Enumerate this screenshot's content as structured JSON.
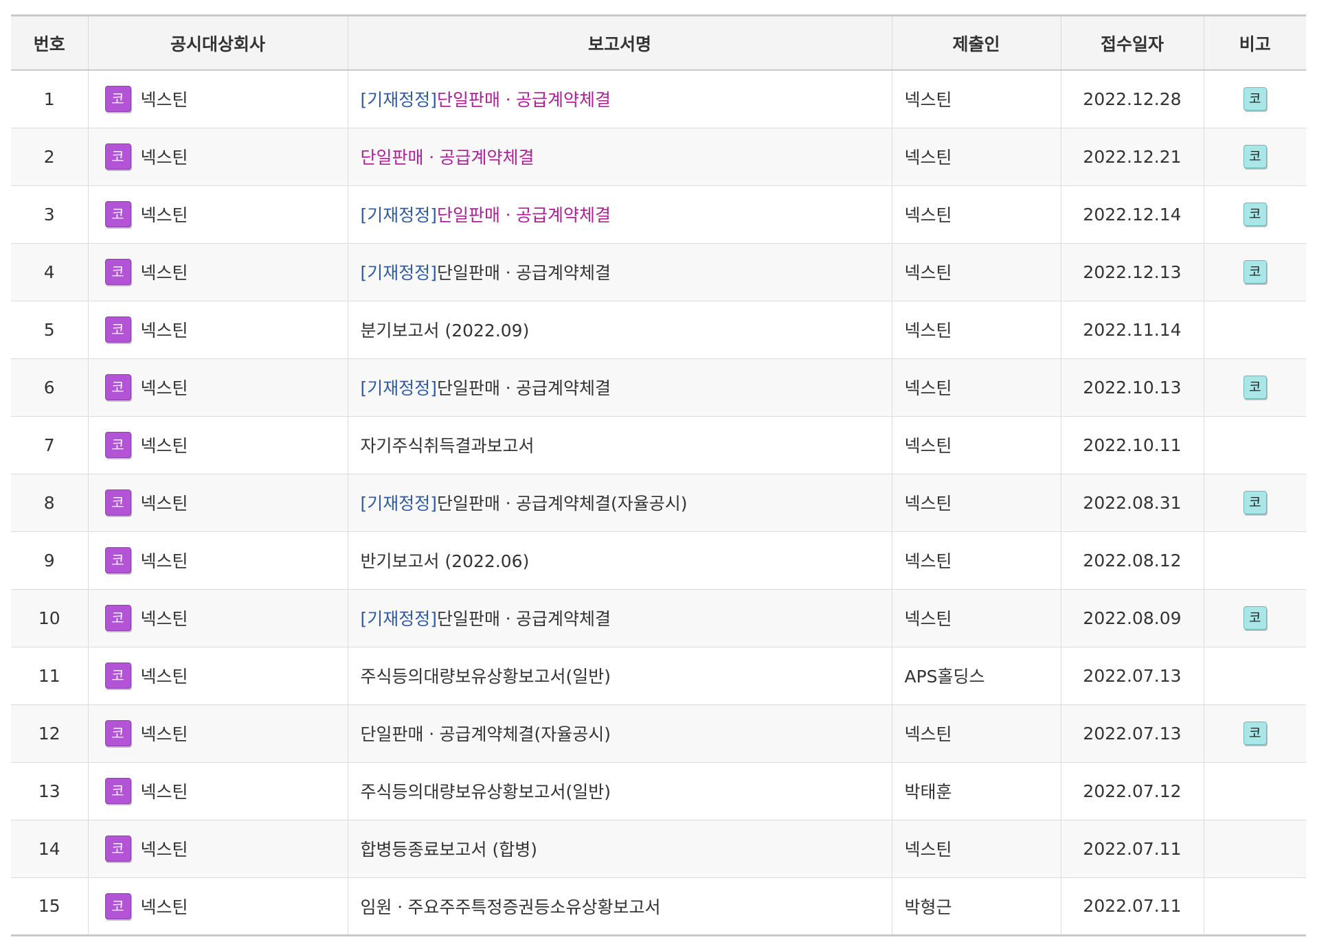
{
  "colors": {
    "prefix": "#2f5aa8",
    "link": "#b01e9a",
    "badge_company": "#b353d6",
    "badge_note": "#a8e6e8"
  },
  "headers": {
    "no": "번호",
    "company": "공시대상회사",
    "report": "보고서명",
    "submitter": "제출인",
    "date": "접수일자",
    "note": "비고"
  },
  "rows": [
    {
      "no": "1",
      "market": "코",
      "company": "넥스틴",
      "prefix": "[기재정정]",
      "title": "단일판매ㆍ공급계약체결",
      "link": true,
      "submitter": "넥스틴",
      "date": "2022.12.28",
      "note": "코"
    },
    {
      "no": "2",
      "market": "코",
      "company": "넥스틴",
      "prefix": "",
      "title": "단일판매ㆍ공급계약체결",
      "link": true,
      "submitter": "넥스틴",
      "date": "2022.12.21",
      "note": "코"
    },
    {
      "no": "3",
      "market": "코",
      "company": "넥스틴",
      "prefix": "[기재정정]",
      "title": "단일판매ㆍ공급계약체결",
      "link": true,
      "submitter": "넥스틴",
      "date": "2022.12.14",
      "note": "코"
    },
    {
      "no": "4",
      "market": "코",
      "company": "넥스틴",
      "prefix": "[기재정정]",
      "title": "단일판매ㆍ공급계약체결",
      "link": false,
      "submitter": "넥스틴",
      "date": "2022.12.13",
      "note": "코"
    },
    {
      "no": "5",
      "market": "코",
      "company": "넥스틴",
      "prefix": "",
      "title": "분기보고서 (2022.09)",
      "link": false,
      "submitter": "넥스틴",
      "date": "2022.11.14",
      "note": ""
    },
    {
      "no": "6",
      "market": "코",
      "company": "넥스틴",
      "prefix": "[기재정정]",
      "title": "단일판매ㆍ공급계약체결",
      "link": false,
      "submitter": "넥스틴",
      "date": "2022.10.13",
      "note": "코"
    },
    {
      "no": "7",
      "market": "코",
      "company": "넥스틴",
      "prefix": "",
      "title": "자기주식취득결과보고서",
      "link": false,
      "submitter": "넥스틴",
      "date": "2022.10.11",
      "note": ""
    },
    {
      "no": "8",
      "market": "코",
      "company": "넥스틴",
      "prefix": "[기재정정]",
      "title": "단일판매ㆍ공급계약체결(자율공시)",
      "link": false,
      "submitter": "넥스틴",
      "date": "2022.08.31",
      "note": "코"
    },
    {
      "no": "9",
      "market": "코",
      "company": "넥스틴",
      "prefix": "",
      "title": "반기보고서 (2022.06)",
      "link": false,
      "submitter": "넥스틴",
      "date": "2022.08.12",
      "note": ""
    },
    {
      "no": "10",
      "market": "코",
      "company": "넥스틴",
      "prefix": "[기재정정]",
      "title": "단일판매ㆍ공급계약체결",
      "link": false,
      "submitter": "넥스틴",
      "date": "2022.08.09",
      "note": "코"
    },
    {
      "no": "11",
      "market": "코",
      "company": "넥스틴",
      "prefix": "",
      "title": "주식등의대량보유상황보고서(일반)",
      "link": false,
      "submitter": "APS홀딩스",
      "date": "2022.07.13",
      "note": ""
    },
    {
      "no": "12",
      "market": "코",
      "company": "넥스틴",
      "prefix": "",
      "title": "단일판매ㆍ공급계약체결(자율공시)",
      "link": false,
      "submitter": "넥스틴",
      "date": "2022.07.13",
      "note": "코"
    },
    {
      "no": "13",
      "market": "코",
      "company": "넥스틴",
      "prefix": "",
      "title": "주식등의대량보유상황보고서(일반)",
      "link": false,
      "submitter": "박태훈",
      "date": "2022.07.12",
      "note": ""
    },
    {
      "no": "14",
      "market": "코",
      "company": "넥스틴",
      "prefix": "",
      "title": "합병등종료보고서 (합병)",
      "link": false,
      "submitter": "넥스틴",
      "date": "2022.07.11",
      "note": ""
    },
    {
      "no": "15",
      "market": "코",
      "company": "넥스틴",
      "prefix": "",
      "title": "임원ㆍ주요주주특정증권등소유상황보고서",
      "link": false,
      "submitter": "박형근",
      "date": "2022.07.11",
      "note": ""
    }
  ]
}
